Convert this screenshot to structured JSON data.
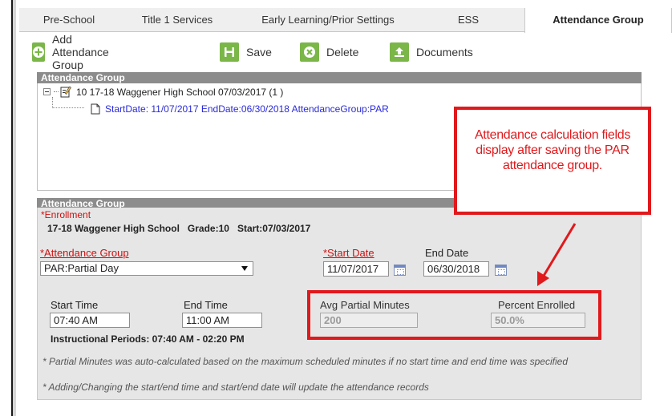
{
  "tabs": [
    {
      "label": "Pre-School"
    },
    {
      "label": "Title 1 Services"
    },
    {
      "label": "Early Learning/Prior Settings"
    },
    {
      "label": "ESS"
    },
    {
      "label": "Attendance Group"
    }
  ],
  "toolbar": {
    "add_label": "Add Attendance Group",
    "save_label": "Save",
    "delete_label": "Delete",
    "documents_label": "Documents"
  },
  "tree": {
    "header": "Attendance Group",
    "root_label": "10 17-18 Waggener High School 07/03/2017 (1 )",
    "child_label": "StartDate: 11/07/2017 EndDate:06/30/2018 AttendanceGroup:PAR"
  },
  "form": {
    "header": "Attendance Group",
    "enrollment_label": "*Enrollment",
    "enrollment_value": "17-18 Waggener High School   Grade:10   Start:07/03/2017",
    "attendance_group_label": "*Attendance Group",
    "attendance_group_value": "PAR:Partial Day",
    "start_date_label": "*Start Date",
    "start_date_value": "11/07/2017",
    "end_date_label": "End Date",
    "end_date_value": "06/30/2018",
    "start_time_label": "Start Time",
    "start_time_value": "07:40 AM",
    "end_time_label": "End Time",
    "end_time_value": "11:00 AM",
    "avg_partial_label": "Avg Partial Minutes",
    "avg_partial_value": "200",
    "percent_enrolled_label": "Percent Enrolled",
    "percent_enrolled_value": "50.0%",
    "instructional_periods": "Instructional Periods: 07:40 AM - 02:20 PM",
    "note1": "* Partial Minutes was auto-calculated based on the maximum scheduled minutes if no start time and end time was specified",
    "note2": "* Adding/Changing the start/end time and start/end date will update the attendance records"
  },
  "callout": {
    "text": "Attendance calculation fields display after saving the PAR attendance group."
  },
  "colors": {
    "accent_green": "#7ab648",
    "annotation_red": "#e0191c",
    "header_gray": "#8c8c8c",
    "link_blue": "#2a2ad8"
  }
}
